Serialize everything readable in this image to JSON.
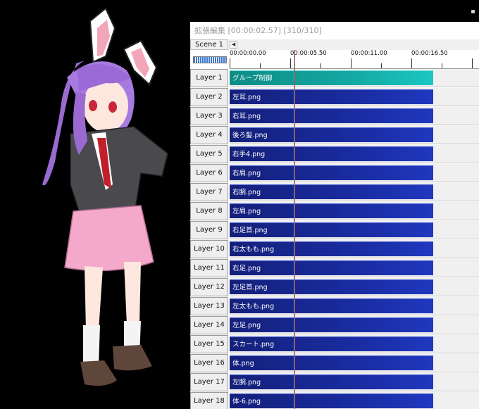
{
  "window": {
    "title": "拡張編集 [00:00:02.57] [310/310]"
  },
  "toolbar": {
    "scene_tab": "Scene 1",
    "scroll_left": "◀"
  },
  "ruler": {
    "times": [
      "00:00:00.00",
      "00:00:05.50",
      "00:00:11.00",
      "00:00:16.50"
    ]
  },
  "layers": [
    {
      "label": "Layer 1",
      "clip": "グループ制御",
      "kind": "group"
    },
    {
      "label": "Layer 2",
      "clip": "左耳.png",
      "kind": "image"
    },
    {
      "label": "Layer 3",
      "clip": "右耳.png",
      "kind": "image"
    },
    {
      "label": "Layer 4",
      "clip": "後ろ髪.png",
      "kind": "image"
    },
    {
      "label": "Layer 5",
      "clip": "右手4.png",
      "kind": "image"
    },
    {
      "label": "Layer 6",
      "clip": "右肩.png",
      "kind": "image"
    },
    {
      "label": "Layer 7",
      "clip": "右腕.png",
      "kind": "image"
    },
    {
      "label": "Layer 8",
      "clip": "左肩.png",
      "kind": "image"
    },
    {
      "label": "Layer 9",
      "clip": "右足首.png",
      "kind": "image"
    },
    {
      "label": "Layer 10",
      "clip": "右太もも.png",
      "kind": "image"
    },
    {
      "label": "Layer 11",
      "clip": "右足.png",
      "kind": "image"
    },
    {
      "label": "Layer 12",
      "clip": "左足首.png",
      "kind": "image"
    },
    {
      "label": "Layer 13",
      "clip": "左太もも.png",
      "kind": "image"
    },
    {
      "label": "Layer 14",
      "clip": "左足.png",
      "kind": "image"
    },
    {
      "label": "Layer 15",
      "clip": "スカート.png",
      "kind": "image"
    },
    {
      "label": "Layer 16",
      "clip": "体.png",
      "kind": "image"
    },
    {
      "label": "Layer 17",
      "clip": "左腕.png",
      "kind": "image"
    },
    {
      "label": "Layer 18",
      "clip": "体-6.png",
      "kind": "image"
    }
  ],
  "colors": {
    "group_clip": "#14a8a2",
    "image_clip": "#1a2ea6",
    "cursor": "#d43a2f"
  }
}
